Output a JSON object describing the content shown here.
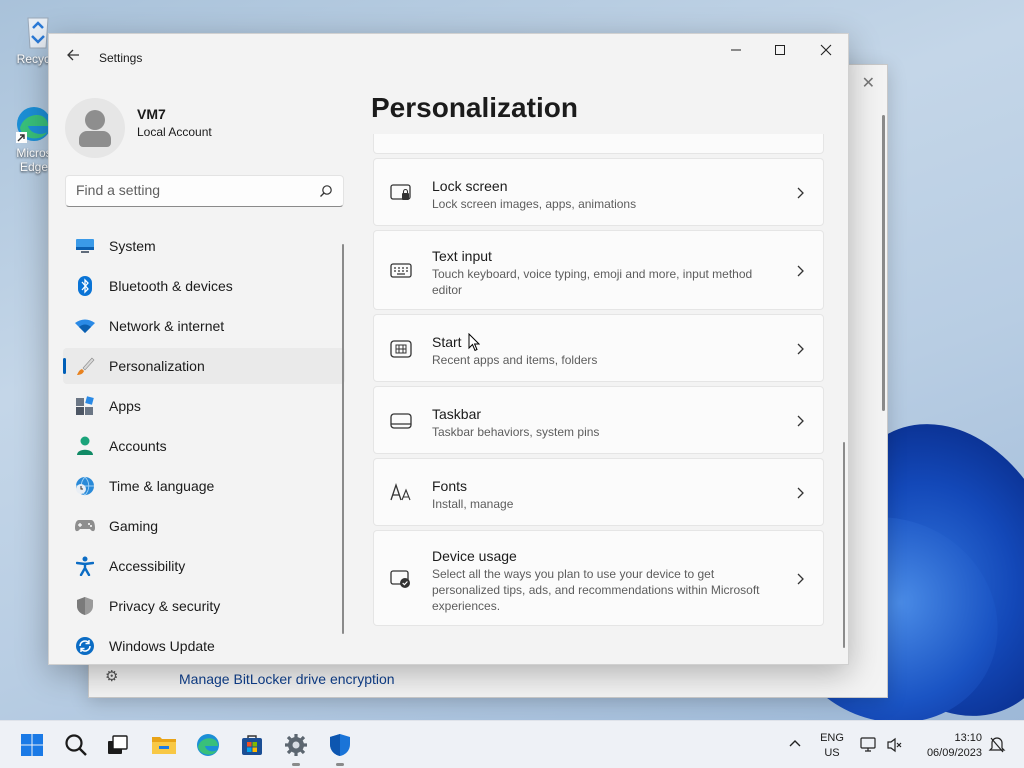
{
  "desktop": {
    "icons": [
      {
        "label": "Recycle",
        "icon": "recycle-bin-icon"
      },
      {
        "label": "Micros Edge",
        "icon": "edge-icon"
      }
    ]
  },
  "background_window": {
    "link": "Manage BitLocker drive encryption"
  },
  "settings": {
    "app_title": "Settings",
    "profile": {
      "name": "VM7",
      "account_type": "Local Account"
    },
    "search": {
      "placeholder": "Find a setting"
    },
    "nav": [
      {
        "label": "System",
        "icon": "monitor-icon",
        "color": "#0078d4"
      },
      {
        "label": "Bluetooth & devices",
        "icon": "bluetooth-icon",
        "color": "#0078d4"
      },
      {
        "label": "Network & internet",
        "icon": "wifi-icon",
        "color": "#0078d4"
      },
      {
        "label": "Personalization",
        "icon": "brush-icon",
        "color": "#e07a1a",
        "active": true
      },
      {
        "label": "Apps",
        "icon": "apps-icon",
        "color": "#5f6b7a"
      },
      {
        "label": "Accounts",
        "icon": "person-icon",
        "color": "#1aa37a"
      },
      {
        "label": "Time & language",
        "icon": "globe-clock-icon",
        "color": "#2a8ad8"
      },
      {
        "label": "Gaming",
        "icon": "gamepad-icon",
        "color": "#6b6b6b"
      },
      {
        "label": "Accessibility",
        "icon": "accessibility-icon",
        "color": "#0b6cc4"
      },
      {
        "label": "Privacy & security",
        "icon": "shield-icon",
        "color": "#7a7a7a"
      },
      {
        "label": "Windows Update",
        "icon": "update-icon",
        "color": "#0b6cc4"
      }
    ],
    "page_title": "Personalization",
    "cards": [
      {
        "title": "Lock screen",
        "desc": "Lock screen images, apps, animations",
        "icon": "lock-screen-icon"
      },
      {
        "title": "Text input",
        "desc": "Touch keyboard, voice typing, emoji and more, input method editor",
        "icon": "keyboard-icon"
      },
      {
        "title": "Start",
        "desc": "Recent apps and items, folders",
        "icon": "start-icon"
      },
      {
        "title": "Taskbar",
        "desc": "Taskbar behaviors, system pins",
        "icon": "taskbar-icon"
      },
      {
        "title": "Fonts",
        "desc": "Install, manage",
        "icon": "fonts-icon"
      },
      {
        "title": "Device usage",
        "desc": "Select all the ways you plan to use your device to get personalized tips, ads, and recommendations within Microsoft experiences.",
        "icon": "device-usage-icon"
      }
    ]
  },
  "taskbar": {
    "language": {
      "line1": "ENG",
      "line2": "US"
    },
    "clock": {
      "time": "13:10",
      "date": "06/09/2023"
    },
    "apps": [
      "start-icon",
      "search-icon",
      "task-view-icon",
      "file-explorer-icon",
      "edge-icon",
      "store-icon",
      "settings-icon",
      "defender-icon"
    ]
  }
}
